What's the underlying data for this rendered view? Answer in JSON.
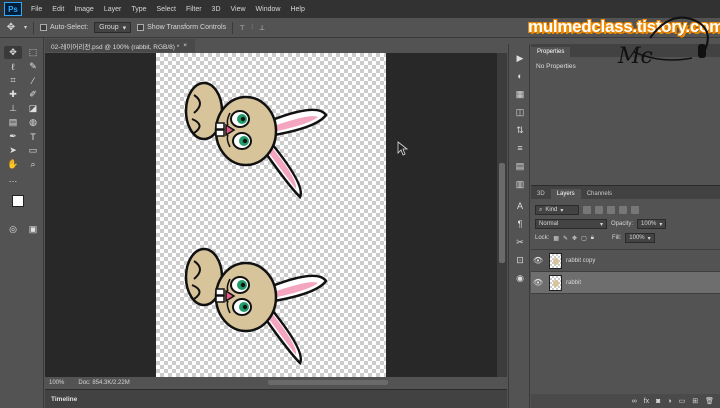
{
  "menubar": {
    "logo": "Ps",
    "items": [
      "File",
      "Edit",
      "Image",
      "Layer",
      "Type",
      "Select",
      "Filter",
      "3D",
      "View",
      "Window",
      "Help"
    ]
  },
  "options": {
    "auto_select_label": "Auto-Select:",
    "auto_select_value": "Group",
    "transform_label": "Show Transform Controls"
  },
  "document": {
    "tab_title": "02-레이어리전.psd @ 100% (rabbit, RGB/8) *",
    "zoom": "100%",
    "doc_size": "Doc: 854.3K/2.22M"
  },
  "timeline": {
    "label": "Timeline"
  },
  "properties": {
    "tab": "Properties",
    "body": "No Properties"
  },
  "layers_panel": {
    "tabs": [
      "3D",
      "Layers",
      "Channels"
    ],
    "kind_label": "Kind",
    "blend_mode": "Normal",
    "opacity_label": "Opacity:",
    "opacity_value": "100%",
    "lock_label": "Lock:",
    "fill_label": "Fill:",
    "fill_value": "100%",
    "layers": [
      {
        "name": "rabbit copy",
        "selected": false
      },
      {
        "name": "rabbit",
        "selected": true
      }
    ]
  },
  "watermark": {
    "site": "mulmedclass.tistory.com",
    "initials": "Mc"
  },
  "colors": {
    "menubar": "#323232",
    "workspace": "#535353",
    "canvas_bg": "#282828",
    "rabbit_fill": "#d8c49a",
    "ear_inner": "#f4a6c0",
    "eye_green": "#1f9c6a",
    "watermark_outline": "#f08a00"
  }
}
